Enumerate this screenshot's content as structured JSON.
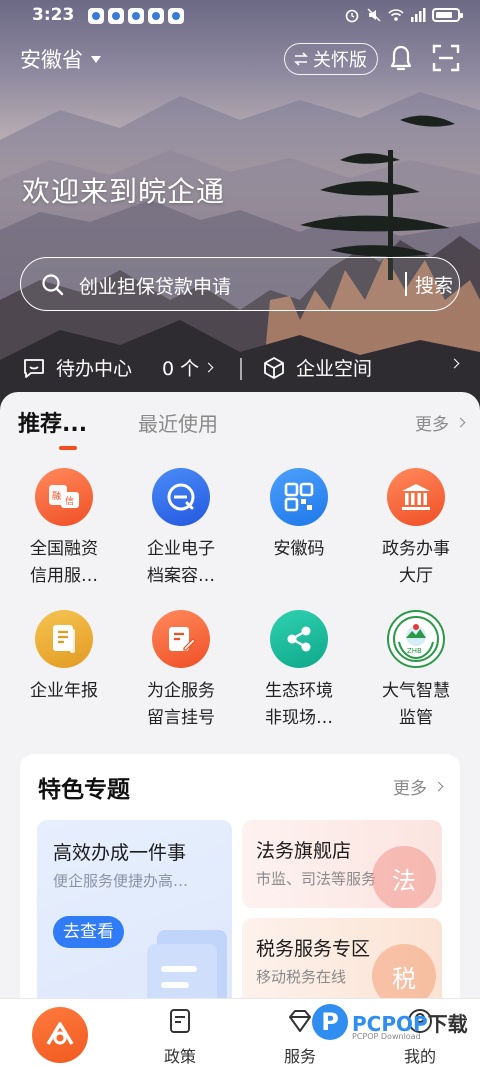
{
  "status_bar": {
    "time": "3:23",
    "app_icons": [
      "gallery-icon",
      "app-icon",
      "music-icon",
      "map-icon",
      "alipay-icon"
    ],
    "right_icons": [
      "alarm-icon",
      "mute-icon",
      "wifi-icon",
      "signal-4g-icon",
      "battery-icon"
    ]
  },
  "header": {
    "province": "安徽省",
    "care_mode_label": "关怀版",
    "welcome": "欢迎来到皖企通"
  },
  "search": {
    "placeholder": "创业担保贷款申请",
    "button_label": "搜索"
  },
  "quickbar": {
    "todo_label": "待办中心",
    "todo_count": "0 个",
    "space_label": "企业空间"
  },
  "tabs": {
    "active": "推荐...",
    "recent": "最近使用",
    "more": "更多"
  },
  "services": [
    {
      "line1": "全国融资",
      "line2": "信用服…",
      "icon": "credit-icon",
      "color": "#f15a2c"
    },
    {
      "line1": "企业电子",
      "line2": "档案容…",
      "icon": "e-archive-icon",
      "color": "#2f6fe8"
    },
    {
      "line1": "安徽码",
      "line2": "",
      "icon": "qr-code-icon",
      "color": "#2f86f0"
    },
    {
      "line1": "政务办事",
      "line2": "大厅",
      "icon": "government-hall-icon",
      "color": "#f15a2c"
    },
    {
      "line1": "企业年报",
      "line2": "",
      "icon": "annual-report-icon",
      "color": "#e9a934"
    },
    {
      "line1": "为企服务",
      "line2": "留言挂号",
      "icon": "message-icon",
      "color": "#f26a2e"
    },
    {
      "line1": "生态环境",
      "line2": "非现场…",
      "icon": "share-nodes-icon",
      "color": "#14b59a"
    },
    {
      "line1": "大气智慧",
      "line2": "监管",
      "icon": "zhb-emblem-icon",
      "color": "#1f8a3a"
    }
  ],
  "featured": {
    "title": "特色专题",
    "more": "更多",
    "big_card": {
      "title": "高效办成一件事",
      "subtitle": "便企服务便捷办高…",
      "button": "去查看"
    },
    "small_cards": [
      {
        "title": "法务旗舰店",
        "subtitle": "市监、司法等服务",
        "watermark": "法"
      },
      {
        "title": "税务服务专区",
        "subtitle": "移动税务在线",
        "watermark": "税"
      }
    ]
  },
  "bottom_nav": {
    "items": [
      {
        "label": "政策",
        "icon": "policy-icon"
      },
      {
        "label": "服务",
        "icon": "service-icon"
      },
      {
        "label": "我的",
        "icon": "profile-icon"
      }
    ]
  },
  "watermark_logo": {
    "letter": "P",
    "name": "PCPOP",
    "name_suffix": "下载",
    "sub": "PCPOP Download"
  }
}
